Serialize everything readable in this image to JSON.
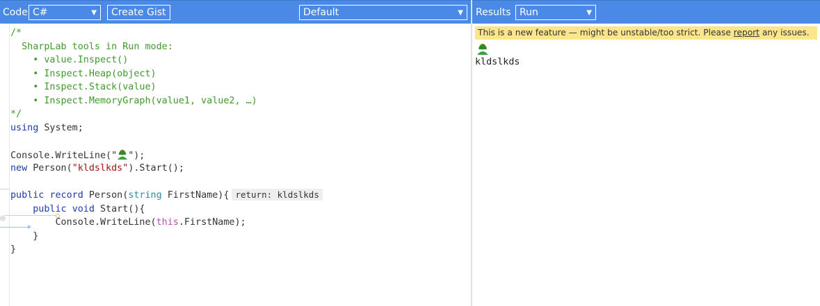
{
  "toolbar": {
    "code_label": "Code",
    "language_value": "C#",
    "create_gist_label": "Create Gist",
    "branch_value": "Default",
    "results_label": "Results",
    "mode_value": "Run"
  },
  "editor": {
    "comment": {
      "open": "/*",
      "heading": "  SharpLab tools in Run mode:",
      "items": [
        "value.Inspect()",
        "Inspect.Heap(object)",
        "Inspect.Stack(value)",
        "Inspect.MemoryGraph(value1, value2, …)"
      ],
      "close": "*/"
    },
    "using_kw": "using",
    "using_rest": " System;",
    "writeline_start": "Console.WriteLine(\"",
    "writeline_end": "\");",
    "new_kw": "new",
    "new_rest": " Person(",
    "new_str": "\"kldslkds\"",
    "new_end": ").Start();",
    "record_kw1": "public",
    "record_kw2": "record",
    "record_name": "Person(",
    "record_type": "string",
    "record_param": " FirstName){",
    "inline_result": "return: kldslkds",
    "method_kw1": "public",
    "method_kw2": "void",
    "method_name": " Start(){",
    "body_start": "Console.WriteLine(",
    "body_this": "this",
    "body_end": ".FirstName);",
    "close_inner": "}",
    "close_outer": "}"
  },
  "results": {
    "warning_text": "This is a new feature — might be unstable/too strict. Please ",
    "warning_link": "report",
    "warning_end": " any issues.",
    "output_text": "kldslkds"
  },
  "colors": {
    "toolbar_bg": "#4a8ae6",
    "comment": "#3f9a2a",
    "keyword": "#1f3aa8",
    "type": "#2b8fa3",
    "string": "#a31515",
    "warning_bg": "#fbe68c"
  },
  "icons": {
    "emoji": "person-emoji-icon",
    "dropdown": "chevron-down-icon",
    "bullet": "bullet-icon"
  }
}
